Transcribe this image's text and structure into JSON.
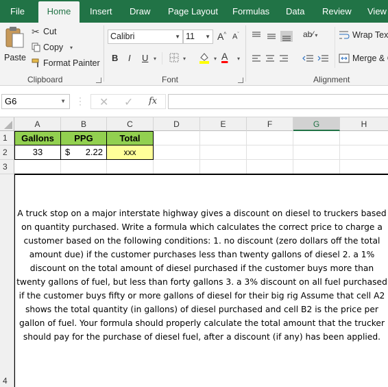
{
  "ribbon_tabs": [
    "File",
    "Home",
    "Insert",
    "Draw",
    "Page Layout",
    "Formulas",
    "Data",
    "Review",
    "View"
  ],
  "active_tab": "Home",
  "clipboard": {
    "paste_label": "Paste",
    "cut_label": "Cut",
    "copy_label": "Copy",
    "format_painter_label": "Format Painter",
    "group_label": "Clipboard"
  },
  "font": {
    "font_name": "Calibri",
    "font_size": "11",
    "bold_label": "B",
    "italic_label": "I",
    "underline_label": "U",
    "grow_label": "A",
    "shrink_label": "A",
    "font_color_label": "A",
    "group_label": "Font"
  },
  "alignment": {
    "wrap_text_label": "Wrap Text",
    "merge_label": "Merge & C",
    "group_label": "Alignment"
  },
  "formula_bar": {
    "name_box": "G6",
    "fx_label": "fx",
    "formula": ""
  },
  "columns": [
    "A",
    "B",
    "C",
    "D",
    "E",
    "F",
    "G",
    "H"
  ],
  "selected_column": "G",
  "rows": [
    "1",
    "2",
    "3",
    "4"
  ],
  "cells": {
    "a1": "Gallons",
    "b1": "PPG",
    "c1": "Total",
    "a2": "33",
    "b2_currency": "$",
    "b2_value": "2.22",
    "c2": "xxx"
  },
  "instructions": "A truck stop on a major interstate highway gives a discount on diesel to truckers based on quantity purchased. Write a formula which calculates the correct price to charge a customer based on the following conditions:    1.  no discount (zero dollars off the total amount due) if the customer purchases less than twenty gallons of diesel    2.  a 1% discount on the total amount of diesel purchased if the customer buys more than twenty gallons of fuel, but less than forty gallons    3.  a 3% discount on all fuel purchased if the customer buys fifty or more gallons of diesel for their big rig    Assume that cell A2 shows the total quantity (in gallons) of diesel purchased and cell B2 is the price per gallon of fuel. Your formula should properly calculate the total amount that the trucker should pay for the purchase of diesel fuel, after a discount (if any) has been applied.",
  "colors": {
    "excel_green": "#217346",
    "header_fill_green": "#92d050",
    "total_fill_yellow": "#ffff99"
  }
}
